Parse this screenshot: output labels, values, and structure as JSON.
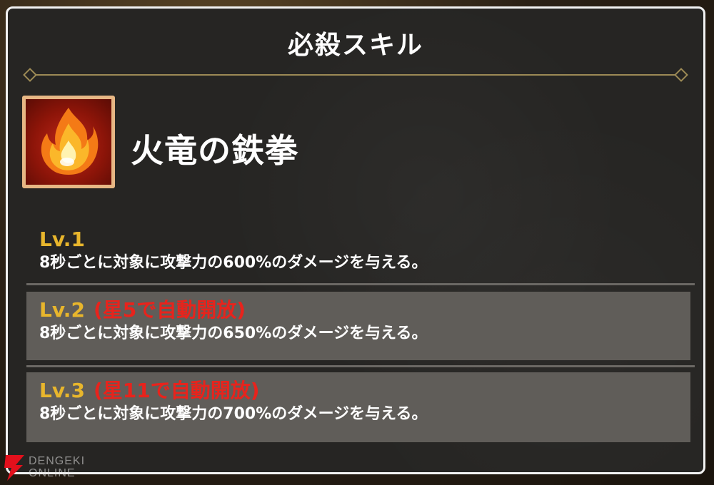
{
  "panel": {
    "title": "必殺スキル"
  },
  "skill": {
    "icon": "fire-icon",
    "name": "火竜の鉄拳"
  },
  "levels": [
    {
      "label": "Lv.1",
      "unlock": "",
      "description": "8秒ごとに対象に攻撃力の600%のダメージを与える。"
    },
    {
      "label": "Lv.2",
      "unlock": "(星5で自動開放)",
      "description": "8秒ごとに対象に攻撃力の650%のダメージを与える。"
    },
    {
      "label": "Lv.3",
      "unlock": "(星11で自動開放)",
      "description": "8秒ごとに対象に攻撃力の700%のダメージを与える。"
    }
  ],
  "watermark": {
    "line1": "DENGEKI",
    "line2": "ONLINE"
  },
  "colors": {
    "level_label": "#e8b62c",
    "unlock_text": "#e8231c",
    "panel_bg": "#262523",
    "boxed_row_bg": "#605d59",
    "divider": "#9c8a55"
  }
}
